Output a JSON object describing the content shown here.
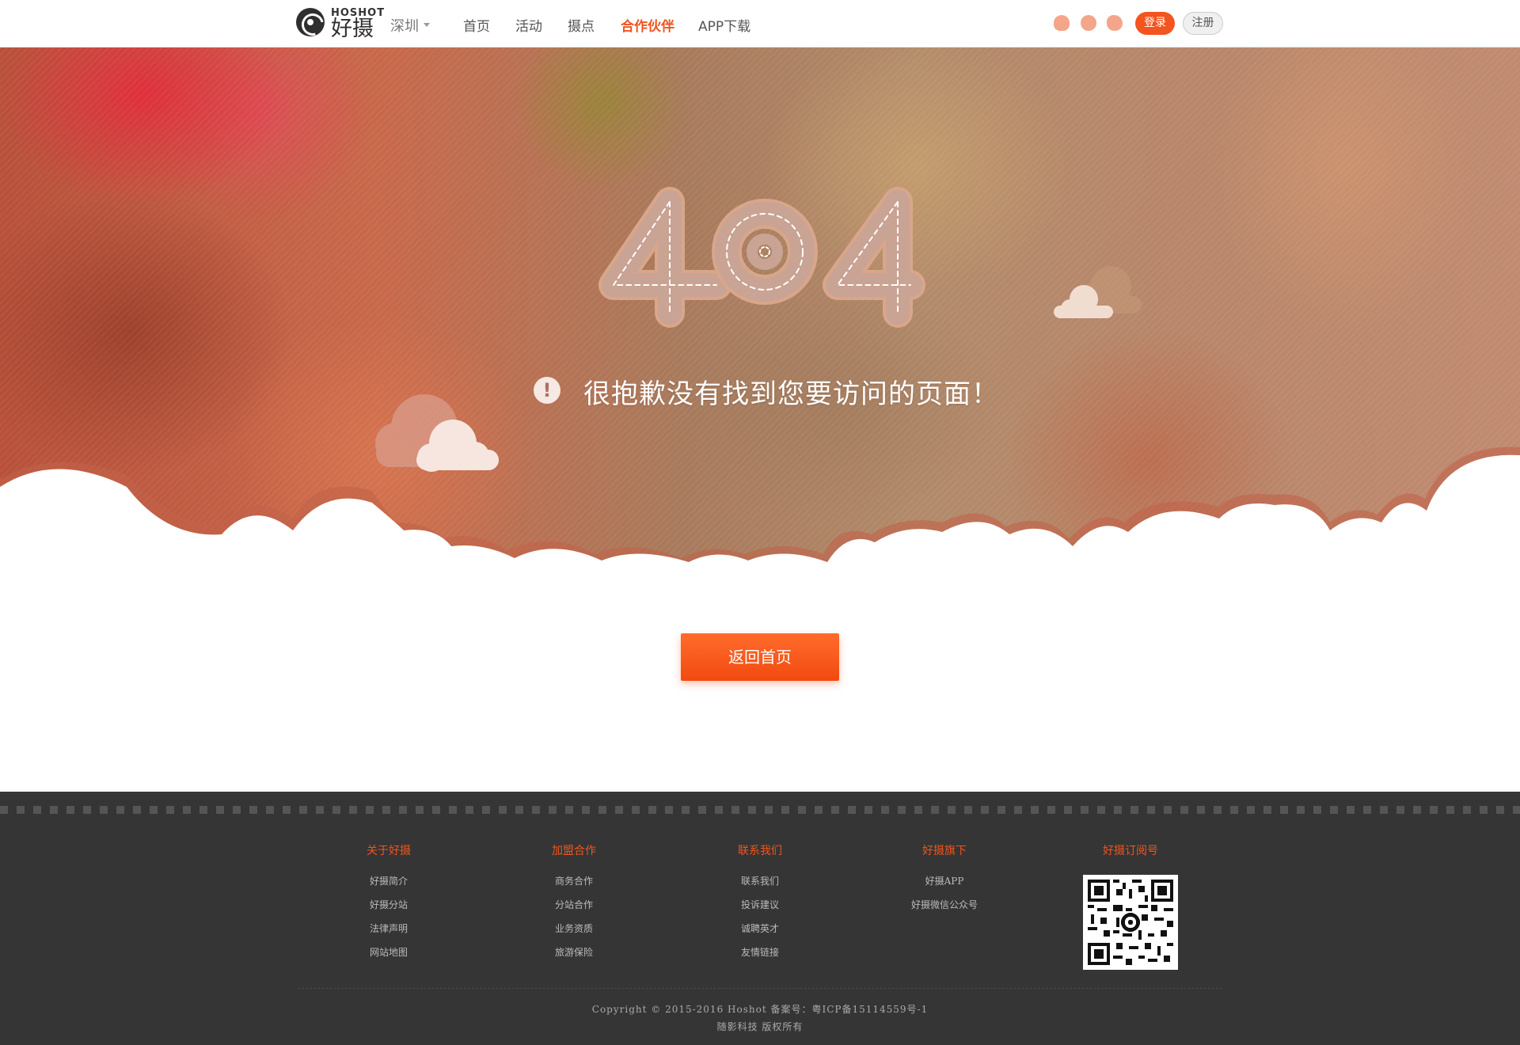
{
  "header": {
    "logo_en": "HOSHOT",
    "logo_cn": "好摄",
    "city": "深圳",
    "nav": [
      "首页",
      "活动",
      "摄点",
      "合作伙伴",
      "APP下载"
    ],
    "active_nav": "合作伙伴",
    "social_icons": [
      "qq-icon",
      "wechat-icon",
      "weibo-icon"
    ],
    "login_label": "登录",
    "register_label": "注册"
  },
  "hero": {
    "code": "404",
    "message": "很抱歉没有找到您要访问的页面！",
    "alert_glyph": "!"
  },
  "main": {
    "home_button": "返回首页"
  },
  "footer": {
    "columns": [
      {
        "title": "关于好摄",
        "links": [
          "好摄简介",
          "好摄分站",
          "法律声明",
          "网站地图"
        ]
      },
      {
        "title": "加盟合作",
        "links": [
          "商务合作",
          "分站合作",
          "业务资质",
          "旅游保险"
        ]
      },
      {
        "title": "联系我们",
        "links": [
          "联系我们",
          "投诉建议",
          "诚聘英才",
          "友情链接"
        ]
      },
      {
        "title": "好摄旗下",
        "links": [
          "好摄APP",
          "好摄微信公众号"
        ]
      },
      {
        "title": "好摄订阅号",
        "links": []
      }
    ],
    "copyright": "Copyright © 2015-2016 Hoshot 备案号：粤ICP备15114559号-1",
    "company": "随影科技 版权所有"
  },
  "colors": {
    "accent": "#f0541e",
    "footer_bg": "#353535",
    "hero_text": "#ffffff"
  }
}
